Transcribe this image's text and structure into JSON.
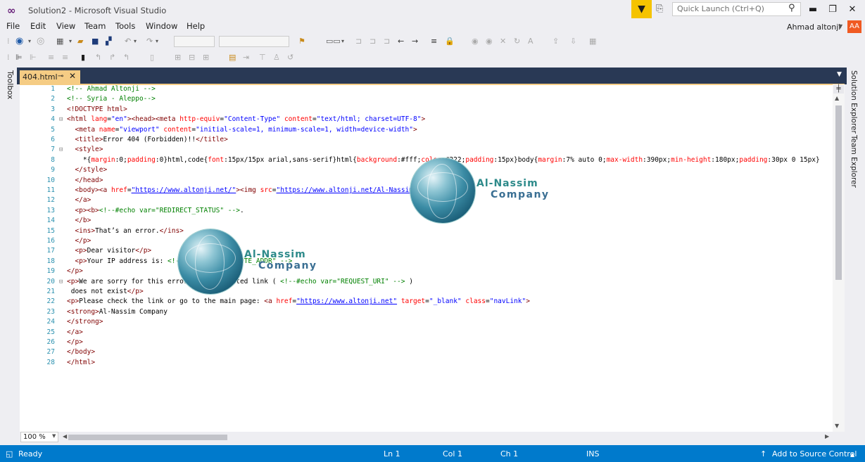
{
  "window": {
    "title": "Solution2 - Microsoft Visual Studio",
    "quick_launch_placeholder": "Quick Launch (Ctrl+Q)",
    "user_name": "Ahmad altonji",
    "avatar_initials": "AA"
  },
  "menu": [
    "File",
    "Edit",
    "View",
    "Team",
    "Tools",
    "Window",
    "Help"
  ],
  "tool_windows": {
    "left": "Toolbox",
    "right": [
      "Solution Explorer",
      "Team Explorer"
    ]
  },
  "document_tab": {
    "label": "404.html",
    "active_color": "#f5cc84"
  },
  "editor": {
    "line_numbers": [
      "1",
      "2",
      "3",
      "4",
      "5",
      "6",
      "7",
      "8",
      "9",
      "10",
      "11",
      "12",
      "13",
      "14",
      "15",
      "16",
      "17",
      "18",
      "19",
      "20",
      "21",
      "22",
      "23",
      "24",
      "25",
      "26",
      "27",
      "28"
    ],
    "zoom": "100 %",
    "lines": [
      {
        "segs": [
          [
            "c-com",
            "<!-- Ahmad Altonji -->"
          ]
        ]
      },
      {
        "segs": [
          [
            "c-com",
            "<!-- Syria - Aleppo-->"
          ]
        ]
      },
      {
        "segs": [
          [
            "c-tag",
            "<!DOCTYPE html>"
          ]
        ]
      },
      {
        "segs": [
          [
            "c-tag",
            "<html "
          ],
          [
            "c-attr",
            "lang"
          ],
          [
            "c-txt",
            "="
          ],
          [
            "c-val",
            "\"en\""
          ],
          [
            "c-tag",
            "><head><meta "
          ],
          [
            "c-attr",
            "http-equiv"
          ],
          [
            "c-txt",
            "="
          ],
          [
            "c-val",
            "\"Content-Type\""
          ],
          [
            "c-txt",
            " "
          ],
          [
            "c-attr",
            "content"
          ],
          [
            "c-txt",
            "="
          ],
          [
            "c-val",
            "\"text/html; charset=UTF-8\""
          ],
          [
            "c-tag",
            ">"
          ]
        ]
      },
      {
        "segs": [
          [
            "c-txt",
            "  "
          ],
          [
            "c-tag",
            "<meta "
          ],
          [
            "c-attr",
            "name"
          ],
          [
            "c-txt",
            "="
          ],
          [
            "c-val",
            "\"viewport\""
          ],
          [
            "c-txt",
            " "
          ],
          [
            "c-attr",
            "content"
          ],
          [
            "c-txt",
            "="
          ],
          [
            "c-val",
            "\"initial-scale=1, minimum-scale=1, width=device-width\""
          ],
          [
            "c-tag",
            ">"
          ]
        ]
      },
      {
        "segs": [
          [
            "c-txt",
            "  "
          ],
          [
            "c-tag",
            "<title>"
          ],
          [
            "c-txt",
            "Error 404 (Forbidden)!!"
          ],
          [
            "c-tag",
            "</title>"
          ]
        ]
      },
      {
        "segs": [
          [
            "c-txt",
            "  "
          ],
          [
            "c-tag",
            "<style>"
          ]
        ]
      },
      {
        "segs": [
          [
            "c-txt",
            "    *{"
          ],
          [
            "c-attr",
            "margin"
          ],
          [
            "c-txt",
            ":0;"
          ],
          [
            "c-attr",
            "padding"
          ],
          [
            "c-txt",
            ":0}html,code{"
          ],
          [
            "c-attr",
            "font"
          ],
          [
            "c-txt",
            ":15px/15px arial,sans-serif}html{"
          ],
          [
            "c-attr",
            "background"
          ],
          [
            "c-txt",
            ":#fff;"
          ],
          [
            "c-attr",
            "color"
          ],
          [
            "c-txt",
            ":#222;"
          ],
          [
            "c-attr",
            "padding"
          ],
          [
            "c-txt",
            ":15px}body{"
          ],
          [
            "c-attr",
            "margin"
          ],
          [
            "c-txt",
            ":7% auto 0;"
          ],
          [
            "c-attr",
            "max-width"
          ],
          [
            "c-txt",
            ":390px;"
          ],
          [
            "c-attr",
            "min-height"
          ],
          [
            "c-txt",
            ":180px;"
          ],
          [
            "c-attr",
            "padding"
          ],
          [
            "c-txt",
            ":30px 0 15px}"
          ]
        ]
      },
      {
        "segs": [
          [
            "c-txt",
            "  "
          ],
          [
            "c-tag",
            "</style>"
          ]
        ]
      },
      {
        "segs": [
          [
            "c-txt",
            "  "
          ],
          [
            "c-tag",
            "</head>"
          ]
        ]
      },
      {
        "segs": [
          [
            "c-txt",
            "  "
          ],
          [
            "c-tag",
            "<body><a "
          ],
          [
            "c-attr",
            "href"
          ],
          [
            "c-txt",
            "="
          ],
          [
            "c-link",
            "\"https://www.altonji.net/\""
          ],
          [
            "c-tag",
            "><img "
          ],
          [
            "c-attr",
            "src"
          ],
          [
            "c-txt",
            "="
          ],
          [
            "c-link",
            "\"https://www.altonji.net/Al-Nassim-logo.png\""
          ],
          [
            "c-tag",
            ">"
          ]
        ]
      },
      {
        "segs": [
          [
            "c-txt",
            "  "
          ],
          [
            "c-tag",
            "</a>"
          ]
        ]
      },
      {
        "segs": [
          [
            "c-txt",
            "  "
          ],
          [
            "c-tag",
            "<p><b>"
          ],
          [
            "c-com",
            "<!--#echo var=\"REDIRECT_STATUS\" -->"
          ],
          [
            "c-txt",
            "."
          ]
        ]
      },
      {
        "segs": [
          [
            "c-txt",
            "  "
          ],
          [
            "c-tag",
            "</b>"
          ]
        ]
      },
      {
        "segs": [
          [
            "c-txt",
            "  "
          ],
          [
            "c-tag",
            "<ins>"
          ],
          [
            "c-txt",
            "That’s an error."
          ],
          [
            "c-tag",
            "</ins>"
          ]
        ]
      },
      {
        "segs": [
          [
            "c-txt",
            "  "
          ],
          [
            "c-tag",
            "</p>"
          ]
        ]
      },
      {
        "segs": [
          [
            "c-txt",
            "  "
          ],
          [
            "c-tag",
            "<p>"
          ],
          [
            "c-txt",
            "Dear visitor"
          ],
          [
            "c-tag",
            "</p>"
          ]
        ]
      },
      {
        "segs": [
          [
            "c-txt",
            "  "
          ],
          [
            "c-tag",
            "<p>"
          ],
          [
            "c-txt",
            "Your IP address is: "
          ],
          [
            "c-com",
            "<!--#echo var=\"REMOTE_ADDR\" -->"
          ]
        ]
      },
      {
        "segs": [
          [
            "c-tag",
            "</p>"
          ]
        ]
      },
      {
        "segs": [
          [
            "c-tag",
            "<p>"
          ],
          [
            "c-txt",
            "We are sorry for this error, the requested link ( "
          ],
          [
            "c-com",
            "<!--#echo var=\"REQUEST_URI\" -->"
          ],
          [
            "c-txt",
            " )"
          ]
        ]
      },
      {
        "segs": [
          [
            "c-txt",
            " does not exist"
          ],
          [
            "c-tag",
            "</p>"
          ]
        ]
      },
      {
        "segs": [
          [
            "c-tag",
            "<p>"
          ],
          [
            "c-txt",
            "Please check the link or go to the main page: "
          ],
          [
            "c-tag",
            "<a "
          ],
          [
            "c-attr",
            "href"
          ],
          [
            "c-txt",
            "="
          ],
          [
            "c-link",
            "\"https://www.altonji.net\""
          ],
          [
            "c-txt",
            " "
          ],
          [
            "c-attr",
            "target"
          ],
          [
            "c-txt",
            "="
          ],
          [
            "c-val",
            "\"_blank\""
          ],
          [
            "c-txt",
            " "
          ],
          [
            "c-attr",
            "class"
          ],
          [
            "c-txt",
            "="
          ],
          [
            "c-val",
            "\"navLink\""
          ],
          [
            "c-tag",
            ">"
          ]
        ]
      },
      {
        "segs": [
          [
            "c-tag",
            "<strong>"
          ],
          [
            "c-txt",
            "Al-Nassim Company"
          ]
        ]
      },
      {
        "segs": [
          [
            "c-tag",
            "</strong>"
          ]
        ]
      },
      {
        "segs": [
          [
            "c-tag",
            "</a>"
          ]
        ]
      },
      {
        "segs": [
          [
            "c-tag",
            "</p>"
          ]
        ]
      },
      {
        "segs": [
          [
            "c-tag",
            "</body>"
          ]
        ]
      },
      {
        "segs": [
          [
            "c-tag",
            "</html>"
          ]
        ]
      }
    ]
  },
  "watermark": {
    "line1": "Al-Nassim",
    "line2": "Company"
  },
  "status_bar": {
    "ready": "Ready",
    "line": "Ln 1",
    "col": "Col 1",
    "ch": "Ch 1",
    "mode": "INS",
    "source_control": "Add to Source Control",
    "color": "#007acc"
  }
}
